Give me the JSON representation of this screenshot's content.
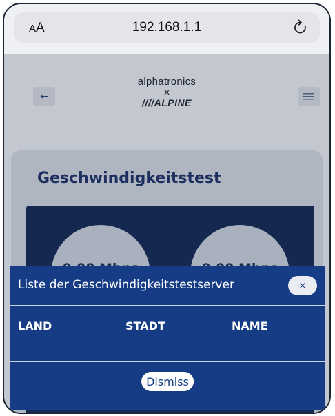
{
  "browser": {
    "text_size_small": "A",
    "text_size_big": "A",
    "url": "192.168.1.1",
    "reload_icon": "reload-icon"
  },
  "header": {
    "back_label": "←",
    "menu_icon": "hamburger-menu-icon",
    "logo_top": "alphatronics",
    "logo_x": "×",
    "logo_bottom": "////ALPINE"
  },
  "speedtest": {
    "title": "Geschwindigkeitstest",
    "download_value": "0.00 Mbps",
    "upload_value": "0.00 Mbps"
  },
  "modal": {
    "title": "Liste der Geschwindigkeitstestserver",
    "close_label": "×",
    "columns": [
      "LAND",
      "STADT",
      "NAME"
    ],
    "dismiss_label": "Dismiss"
  },
  "colors": {
    "modal_bg": "#163c85",
    "panel_bg": "#15284f",
    "title_color": "#1c2f5f"
  }
}
